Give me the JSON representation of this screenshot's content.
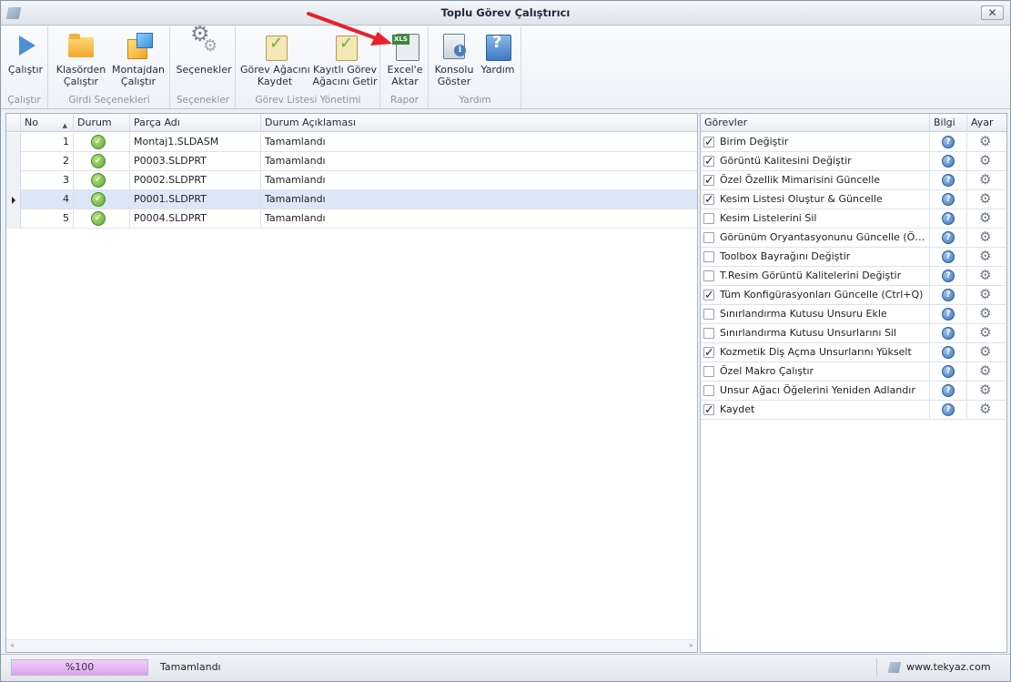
{
  "window": {
    "title": "Toplu Görev Çalıştırıcı",
    "close_glyph": "✕"
  },
  "ribbon": {
    "groups": [
      {
        "caption": "Çalıştır",
        "buttons": [
          {
            "label": "Çalıştır",
            "icon": "play-icon"
          }
        ]
      },
      {
        "caption": "Girdi Seçenekleri",
        "buttons": [
          {
            "label": "Klasörden\nÇalıştır",
            "icon": "folder-icon"
          },
          {
            "label": "Montajdan\nÇalıştır",
            "icon": "assembly-icon"
          }
        ]
      },
      {
        "caption": "Seçenekler",
        "buttons": [
          {
            "label": "Seçenekler",
            "icon": "gears-icon"
          }
        ]
      },
      {
        "caption": "Görev Listesi Yönetimi",
        "buttons": [
          {
            "label": "Görev Ağacını\nKaydet",
            "icon": "clipboard-save-icon"
          },
          {
            "label": "Kayıtlı Görev\nAğacını Getir",
            "icon": "clipboard-check-icon"
          }
        ]
      },
      {
        "caption": "Rapor",
        "buttons": [
          {
            "label": "Excel'e\nAktar",
            "icon": "excel-export-icon"
          }
        ]
      },
      {
        "caption": "Yardım",
        "buttons": [
          {
            "label": "Konsolu\nGöster",
            "icon": "console-icon"
          },
          {
            "label": "Yardım",
            "icon": "help-icon"
          }
        ]
      }
    ]
  },
  "parts_grid": {
    "columns": [
      "No",
      "Durum",
      "Parça Adı",
      "Durum Açıklaması"
    ],
    "sort_glyph": "▲",
    "rows": [
      {
        "no": "1",
        "status_icon": "success-icon",
        "part": "Montaj1.SLDASM",
        "desc": "Tamamlandı",
        "selected": false
      },
      {
        "no": "2",
        "status_icon": "success-icon",
        "part": "P0003.SLDPRT",
        "desc": "Tamamlandı",
        "selected": false
      },
      {
        "no": "3",
        "status_icon": "success-icon",
        "part": "P0002.SLDPRT",
        "desc": "Tamamlandı",
        "selected": false
      },
      {
        "no": "4",
        "status_icon": "success-icon",
        "part": "P0001.SLDPRT",
        "desc": "Tamamlandı",
        "selected": true
      },
      {
        "no": "5",
        "status_icon": "success-icon",
        "part": "P0004.SLDPRT",
        "desc": "Tamamlandı",
        "selected": false
      }
    ],
    "scroll_left_glyph": "◂",
    "scroll_right_glyph": "▸"
  },
  "tasks_grid": {
    "columns": [
      "Görevler",
      "Bilgi",
      "Ayar"
    ],
    "rows": [
      {
        "label": "Birim Değiştir",
        "checked": true
      },
      {
        "label": "Görüntü Kalitesini Değiştir",
        "checked": true
      },
      {
        "label": "Özel Özellik Mimarisini Güncelle",
        "checked": true
      },
      {
        "label": "Kesim Listesi Oluştur & Güncelle",
        "checked": true
      },
      {
        "label": "Kesim Listelerini Sil",
        "checked": false
      },
      {
        "label": "Görünüm Oryantasyonunu Güncelle (Ön, Sağ...",
        "checked": false
      },
      {
        "label": "Toolbox Bayrağını Değiştir",
        "checked": false
      },
      {
        "label": "T.Resim Görüntü Kalitelerini Değiştir",
        "checked": false
      },
      {
        "label": "Tüm Konfigürasyonları Güncelle (Ctrl+Q)",
        "checked": true
      },
      {
        "label": "Sınırlandırma Kutusu Unsuru Ekle",
        "checked": false
      },
      {
        "label": "Sınırlandırma Kutusu Unsurlarını Sil",
        "checked": false
      },
      {
        "label": "Kozmetik Diş Açma Unsurlarını Yükselt",
        "checked": true
      },
      {
        "label": "Özel Makro Çalıştır",
        "checked": false
      },
      {
        "label": "Unsur Ağacı Öğelerini Yeniden Adlandır",
        "checked": false
      },
      {
        "label": "Kaydet",
        "checked": true
      }
    ],
    "info_glyph": "?",
    "gear_glyph": "⚙"
  },
  "statusbar": {
    "progress_text": "%100",
    "progress_fraction": 1.0,
    "status_text": "Tamamlandı",
    "website": "www.tekyaz.com"
  },
  "colors": {
    "annotation_arrow": "#e8202a",
    "selection": "#dce7f7",
    "progress_fill": "#dca4ef"
  }
}
